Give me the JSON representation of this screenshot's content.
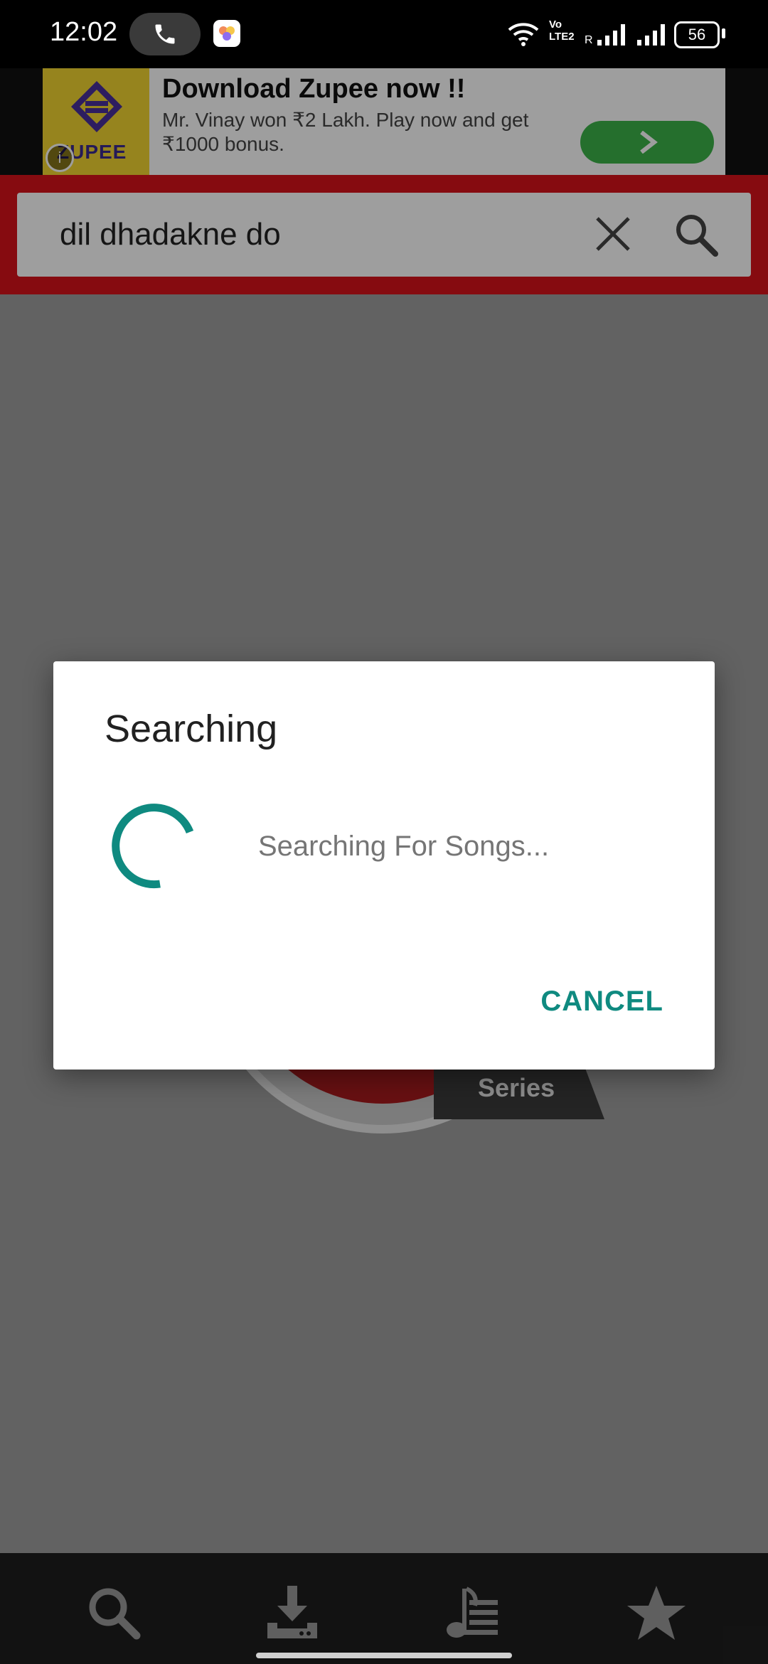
{
  "status_bar": {
    "time": "12:02",
    "battery": "56",
    "network_label": "Vo LTE2",
    "roaming": "R"
  },
  "ad": {
    "brand": "ZUPEE",
    "title": "Download Zupee now !!",
    "description": "Mr. Vinay won ₹2 Lakh. Play now and get ₹1000 bonus.",
    "info_glyph": "i"
  },
  "search": {
    "query": "dil dhadakne do"
  },
  "background_logo": {
    "series_label": "Series"
  },
  "dialog": {
    "title": "Searching",
    "message": "Searching For Songs...",
    "cancel_label": "CANCEL"
  },
  "colors": {
    "toolbar_red": "#d8121a",
    "accent_teal": "#0f8a80",
    "nav_bg": "#1e1e1e"
  },
  "bottom_nav": {
    "items": [
      "search-icon",
      "download-icon",
      "music-library-icon",
      "star-icon"
    ]
  }
}
